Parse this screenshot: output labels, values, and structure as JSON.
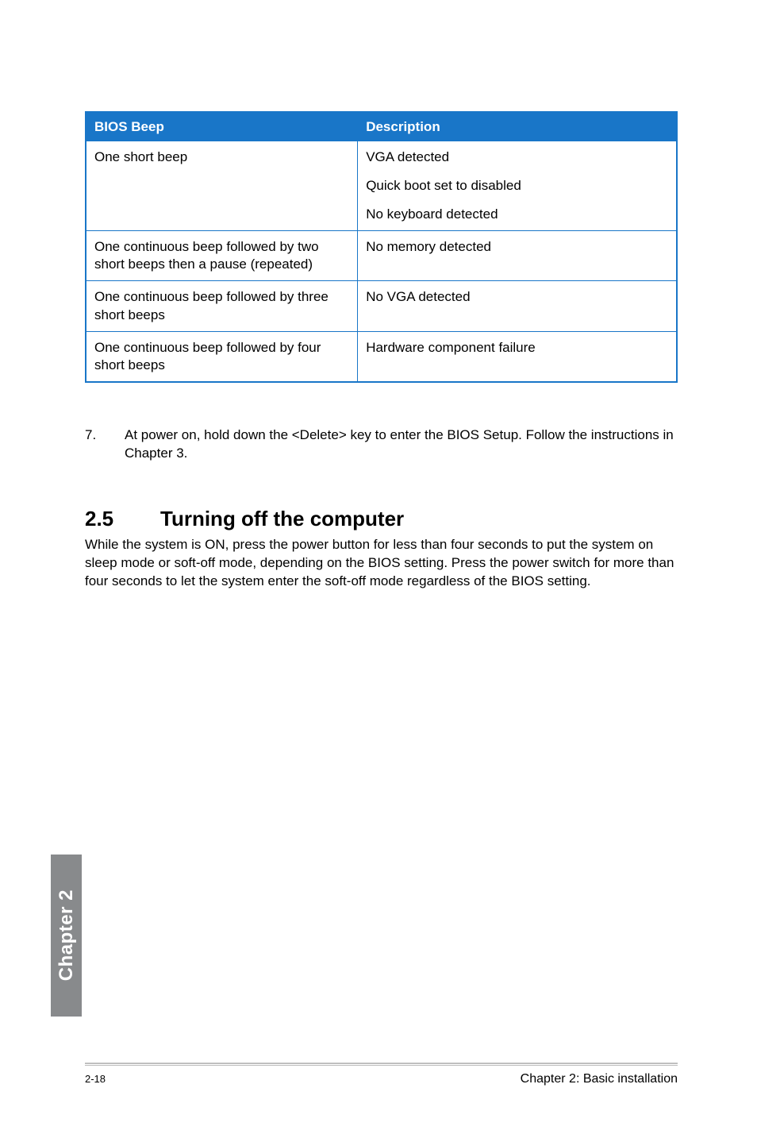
{
  "table": {
    "headers": [
      "BIOS Beep",
      "Description"
    ],
    "rows": [
      {
        "beep": "One short beep",
        "desc": [
          "VGA detected",
          "Quick boot set to disabled",
          "No keyboard detected"
        ]
      },
      {
        "beep": "One continuous beep followed by two short beeps then a pause (repeated)",
        "desc": [
          "No memory detected"
        ]
      },
      {
        "beep": "One continuous beep followed by three short beeps",
        "desc": [
          "No VGA detected"
        ]
      },
      {
        "beep": "One continuous beep followed by four short beeps",
        "desc": [
          "Hardware component failure"
        ]
      }
    ]
  },
  "instruction": {
    "num": "7.",
    "text": "At power on, hold down the <Delete> key to enter the BIOS Setup. Follow the instructions in Chapter 3."
  },
  "section": {
    "number": "2.5",
    "title": "Turning off the computer",
    "body": "While the system is ON, press the power button for less than four seconds to put the system on sleep mode or soft-off mode, depending on the BIOS setting. Press the power switch for more than four seconds to let the system enter the soft-off mode regardless of the BIOS setting."
  },
  "chapter_tab": "Chapter 2",
  "footer": {
    "page": "2-18",
    "chapter": "Chapter 2: Basic installation"
  }
}
